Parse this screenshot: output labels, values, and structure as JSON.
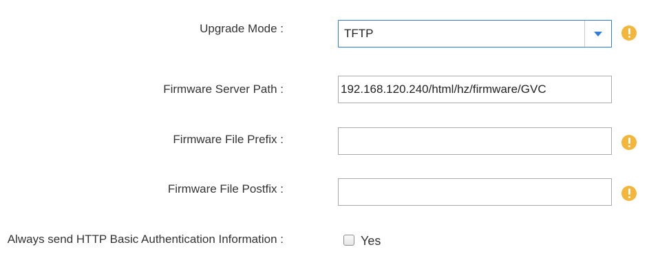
{
  "form": {
    "upgrade_mode": {
      "label": "Upgrade Mode :",
      "value": "TFTP"
    },
    "firmware_server_path": {
      "label": "Firmware Server Path :",
      "value": "192.168.120.240/html/hz/firmware/GVC"
    },
    "firmware_file_prefix": {
      "label": "Firmware File Prefix :",
      "value": ""
    },
    "firmware_file_postfix": {
      "label": "Firmware File Postfix :",
      "value": ""
    },
    "http_basic_auth": {
      "label": "Always send HTTP Basic Authentication Information :",
      "option_label": "Yes",
      "checked": false
    }
  },
  "colors": {
    "accent": "#2f7fd8",
    "warning": "#f3b63a"
  },
  "icons": {
    "select_arrow": "caret-down-icon",
    "warning": "exclamation-circle-icon"
  }
}
